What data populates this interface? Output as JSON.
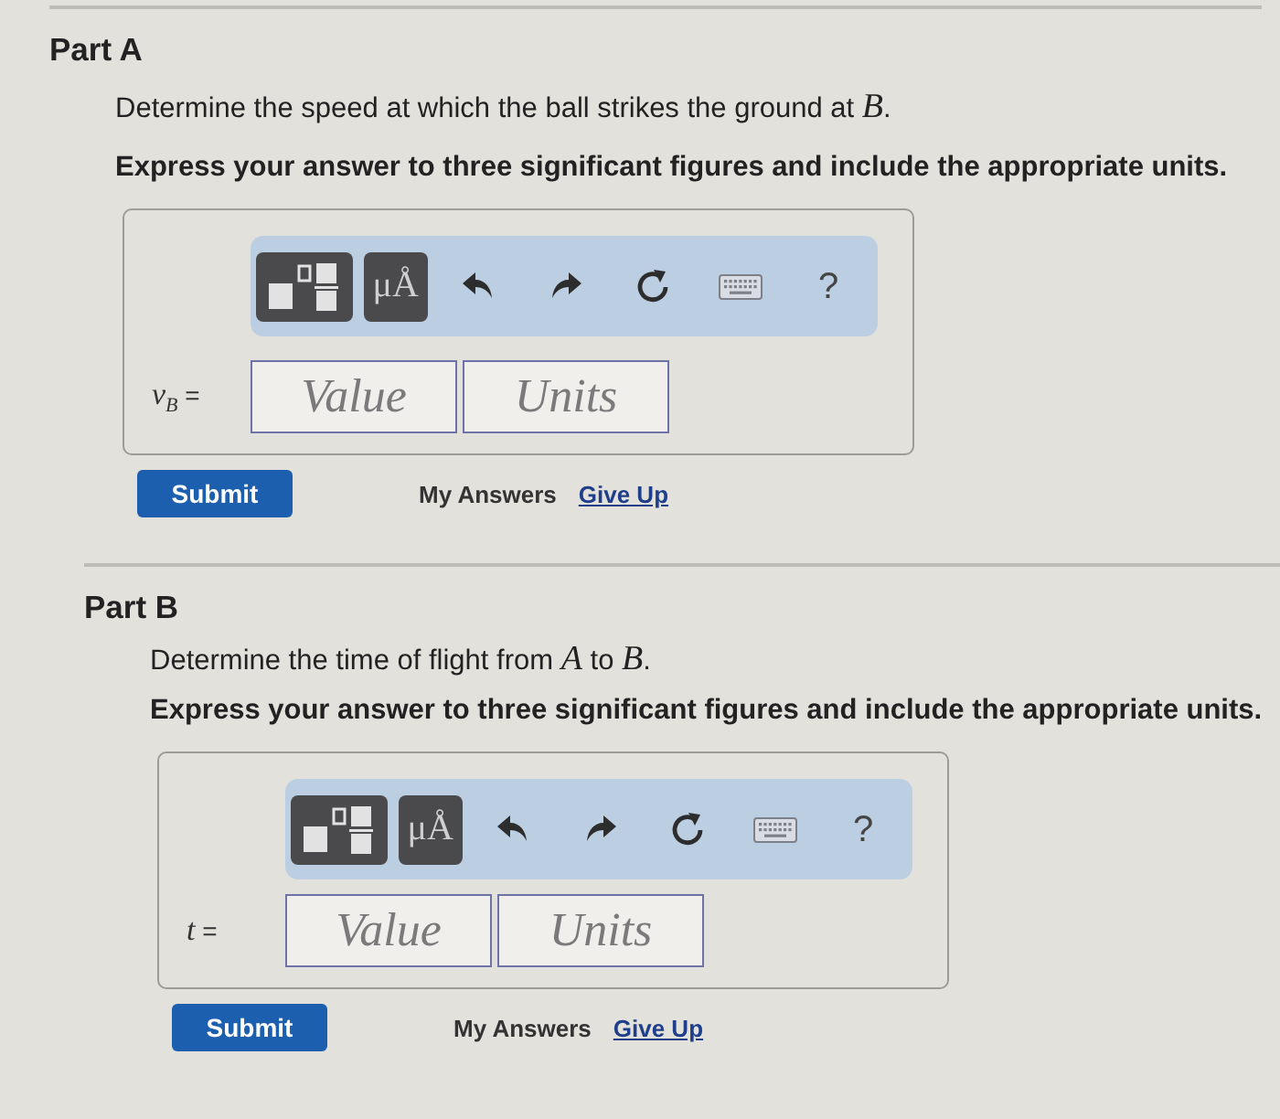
{
  "parts": [
    {
      "title": "Part A",
      "question": "Determine the speed at which the ball strikes the ground at *B*.",
      "instruction": "Express your answer to three significant figures and include the appropriate units.",
      "toolbar": {
        "symbols_label": "μÅ",
        "help_label": "?"
      },
      "answer": {
        "symbol": "v",
        "subscript": "B",
        "sign": "=",
        "value_placeholder": "Value",
        "units_placeholder": "Units"
      },
      "actions": {
        "submit": "Submit",
        "my_answers": "My Answers",
        "give_up": "Give Up"
      }
    },
    {
      "title": "Part B",
      "question": "Determine the time of flight from *A* to *B*.",
      "instruction": "Express your answer to three significant figures and include the appropriate units.",
      "toolbar": {
        "symbols_label": "μÅ",
        "help_label": "?"
      },
      "answer": {
        "symbol": "t",
        "sign": "=",
        "value_placeholder": "Value",
        "units_placeholder": "Units"
      },
      "actions": {
        "submit": "Submit",
        "my_answers": "My Answers",
        "give_up": "Give Up"
      }
    }
  ]
}
